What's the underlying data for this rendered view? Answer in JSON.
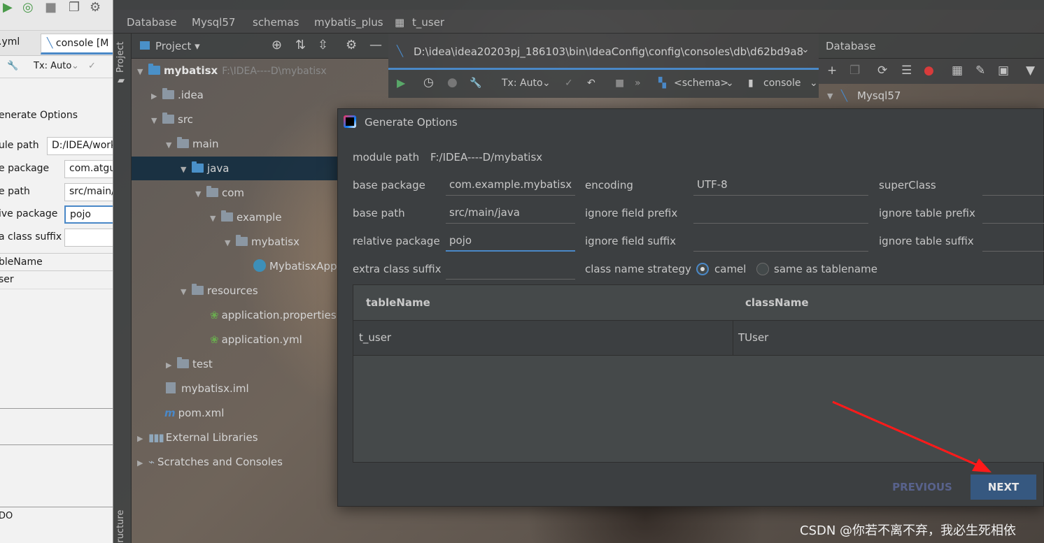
{
  "left_panel": {
    "tabs": [
      ".yml",
      "console [M"
    ],
    "tx_mode": "Tx: Auto",
    "dialog_title": "enerate Options",
    "fields": [
      {
        "label": "ule path",
        "value": "D:/IDEA/work"
      },
      {
        "label": "e package",
        "value": "com.atgu"
      },
      {
        "label": "e path",
        "value": "src/main/"
      },
      {
        "label": "ive package",
        "value": "pojo"
      },
      {
        "label": "a class suffix",
        "value": ""
      }
    ],
    "table_header": "bleName",
    "table_row": "ser",
    "bottom_value": "DO"
  },
  "breadcrumb": [
    "Database",
    "Mysql57",
    "schemas",
    "mybatis_plus",
    "t_user"
  ],
  "tool_strip": {
    "top": "Project",
    "bottom": "Structure"
  },
  "project": {
    "title": "Project",
    "root": {
      "name": "mybatisx",
      "path": "F:\\IDEA----D\\mybatisx"
    },
    "nodes": [
      ".idea",
      "src",
      "main",
      "java",
      "com",
      "example",
      "mybatisx",
      "MybatisxApp",
      "resources",
      "application.properties",
      "application.yml",
      "test",
      "mybatisx.iml",
      "pom.xml",
      "External Libraries",
      "Scratches and Consoles"
    ]
  },
  "console": {
    "path": "D:\\idea\\idea20203pj_186103\\bin\\IdeaConfig\\config\\consoles\\db\\d62bd9a8",
    "tx_mode": "Tx: Auto",
    "schema": "<schema>",
    "console_label": "console"
  },
  "database": {
    "title": "Database",
    "node": "Mysql57"
  },
  "dialog": {
    "title": "Generate Options",
    "module_path": {
      "label": "module path",
      "value": "F:/IDEA----D/mybatisx"
    },
    "base_package": {
      "label": "base package",
      "value": "com.example.mybatisx"
    },
    "base_path": {
      "label": "base path",
      "value": "src/main/java"
    },
    "relative_package": {
      "label": "relative package",
      "value": "pojo"
    },
    "extra_class_suffix": {
      "label": "extra class suffix",
      "value": ""
    },
    "encoding": {
      "label": "encoding",
      "value": "UTF-8"
    },
    "ignore_field_prefix": {
      "label": "ignore field prefix",
      "value": ""
    },
    "ignore_field_suffix": {
      "label": "ignore field suffix",
      "value": ""
    },
    "class_name_strategy": {
      "label": "class name strategy",
      "options": [
        "camel",
        "same as tablename"
      ],
      "selected": "camel"
    },
    "super_class": {
      "label": "superClass",
      "value": ""
    },
    "ignore_table_prefix": {
      "label": "ignore table prefix",
      "value": ""
    },
    "ignore_table_suffix": {
      "label": "ignore table suffix",
      "value": ""
    },
    "table": {
      "columns": [
        "tableName",
        "className"
      ],
      "rows": [
        [
          "t_user",
          "TUser"
        ]
      ]
    },
    "buttons": {
      "previous": "PREVIOUS",
      "next": "NEXT"
    }
  },
  "watermark": "CSDN @你若不离不弃，我必生死相依",
  "colors": {
    "accent": "#4a88c7",
    "next_button": "#365880",
    "arrow": "#ff1a1a"
  }
}
